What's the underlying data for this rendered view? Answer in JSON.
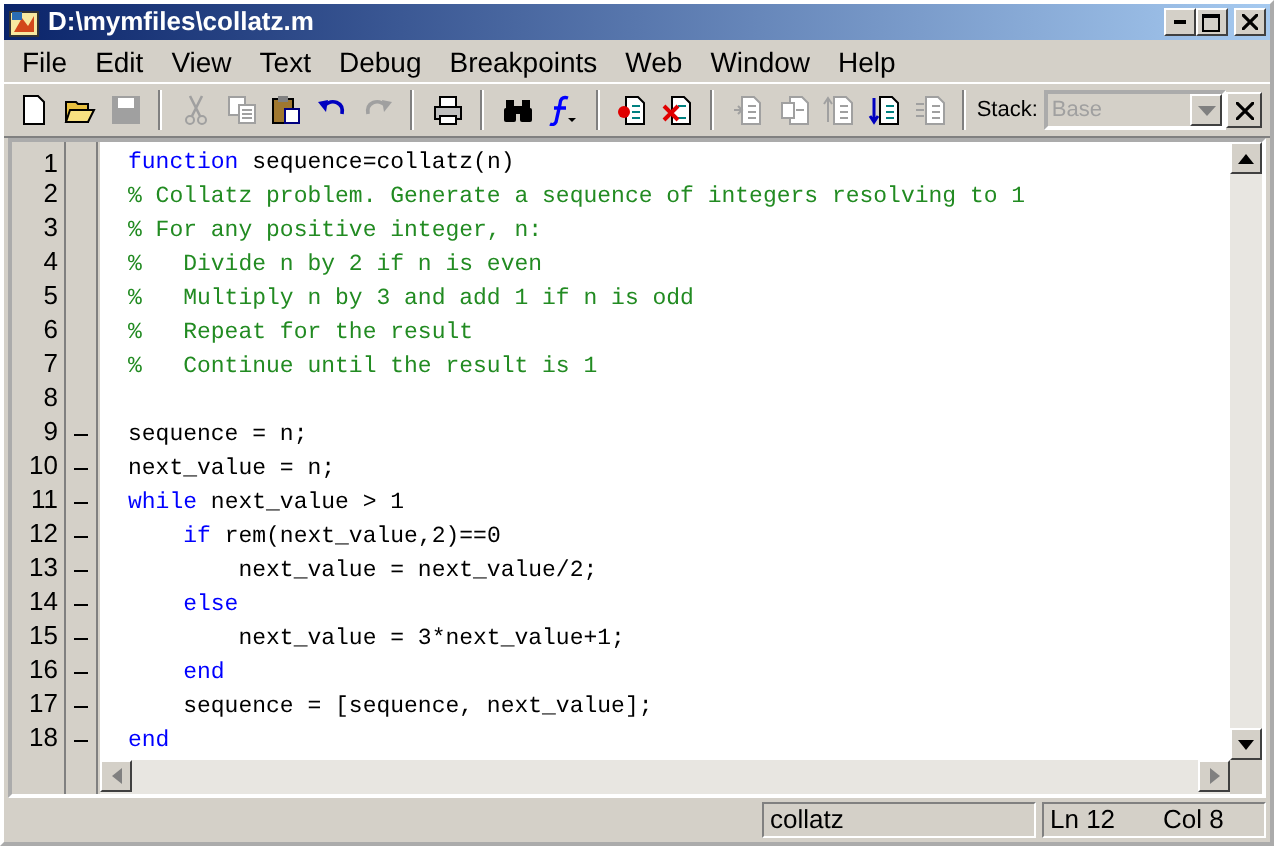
{
  "window": {
    "title": "D:\\mymfiles\\collatz.m"
  },
  "menu": [
    "File",
    "Edit",
    "View",
    "Text",
    "Debug",
    "Breakpoints",
    "Web",
    "Window",
    "Help"
  ],
  "toolbar_groups": [
    [
      {
        "disabled": false
      },
      {
        "disabled": false
      },
      {
        "disabled": true
      }
    ],
    [
      {
        "disabled": true
      },
      {
        "disabled": true
      },
      {
        "disabled": false
      },
      {
        "disabled": false
      },
      {
        "disabled": true
      }
    ],
    [
      {
        "disabled": false
      }
    ],
    [
      {
        "disabled": false
      },
      {
        "disabled": false
      }
    ],
    [
      {
        "disabled": false
      },
      {
        "disabled": false
      }
    ],
    [
      {
        "disabled": true
      },
      {
        "disabled": true
      },
      {
        "disabled": true
      },
      {
        "disabled": false
      },
      {
        "disabled": true
      }
    ]
  ],
  "stack": {
    "label": "Stack:",
    "value": "Base",
    "disabled": true
  },
  "lines": [
    {
      "number": "1",
      "executable": false,
      "tokens": [
        {
          "kind": "keyword",
          "text": "function"
        },
        {
          "kind": "plain",
          "text": " sequence=collatz(n)"
        }
      ]
    },
    {
      "number": "2",
      "executable": false,
      "tokens": [
        {
          "kind": "comment",
          "text": "% Collatz problem. Generate a sequence of integers resolving to 1"
        }
      ]
    },
    {
      "number": "3",
      "executable": false,
      "tokens": [
        {
          "kind": "comment",
          "text": "% For any positive integer, n:"
        }
      ]
    },
    {
      "number": "4",
      "executable": false,
      "tokens": [
        {
          "kind": "comment",
          "text": "%   Divide n by 2 if n is even"
        }
      ]
    },
    {
      "number": "5",
      "executable": false,
      "tokens": [
        {
          "kind": "comment",
          "text": "%   Multiply n by 3 and add 1 if n is odd"
        }
      ]
    },
    {
      "number": "6",
      "executable": false,
      "tokens": [
        {
          "kind": "comment",
          "text": "%   Repeat for the result"
        }
      ]
    },
    {
      "number": "7",
      "executable": false,
      "tokens": [
        {
          "kind": "comment",
          "text": "%   Continue until the result is 1"
        }
      ]
    },
    {
      "number": "8",
      "executable": false
    },
    {
      "number": "9",
      "executable": true,
      "tokens": [
        {
          "kind": "plain",
          "text": "sequence = n;"
        }
      ]
    },
    {
      "number": "10",
      "executable": true,
      "tokens": [
        {
          "kind": "plain",
          "text": "next_value = n;"
        }
      ]
    },
    {
      "number": "11",
      "executable": true,
      "tokens": [
        {
          "kind": "keyword",
          "text": "while"
        },
        {
          "kind": "plain",
          "text": " next_value > 1"
        }
      ]
    },
    {
      "number": "12",
      "executable": true,
      "tokens": [
        {
          "kind": "keyword",
          "text": "    if"
        },
        {
          "kind": "plain",
          "text": " rem(next_value,2)==0"
        }
      ]
    },
    {
      "number": "13",
      "executable": true,
      "tokens": [
        {
          "kind": "plain",
          "text": "        next_value = next_value/2;"
        }
      ]
    },
    {
      "number": "14",
      "executable": true,
      "tokens": [
        {
          "kind": "keyword",
          "text": "    else"
        }
      ]
    },
    {
      "number": "15",
      "executable": true,
      "tokens": [
        {
          "kind": "plain",
          "text": "        next_value = 3*next_value+1;"
        }
      ]
    },
    {
      "number": "16",
      "executable": true,
      "tokens": [
        {
          "kind": "keyword",
          "text": "    end"
        }
      ]
    },
    {
      "number": "17",
      "executable": true,
      "tokens": [
        {
          "kind": "plain",
          "text": "    sequence = [sequence, next_value];"
        }
      ]
    },
    {
      "number": "18",
      "executable": true,
      "tokens": [
        {
          "kind": "keyword",
          "text": "end"
        }
      ]
    }
  ],
  "status_bar": {
    "function": "collatz",
    "line": "Ln 12",
    "column": "Col 8"
  }
}
